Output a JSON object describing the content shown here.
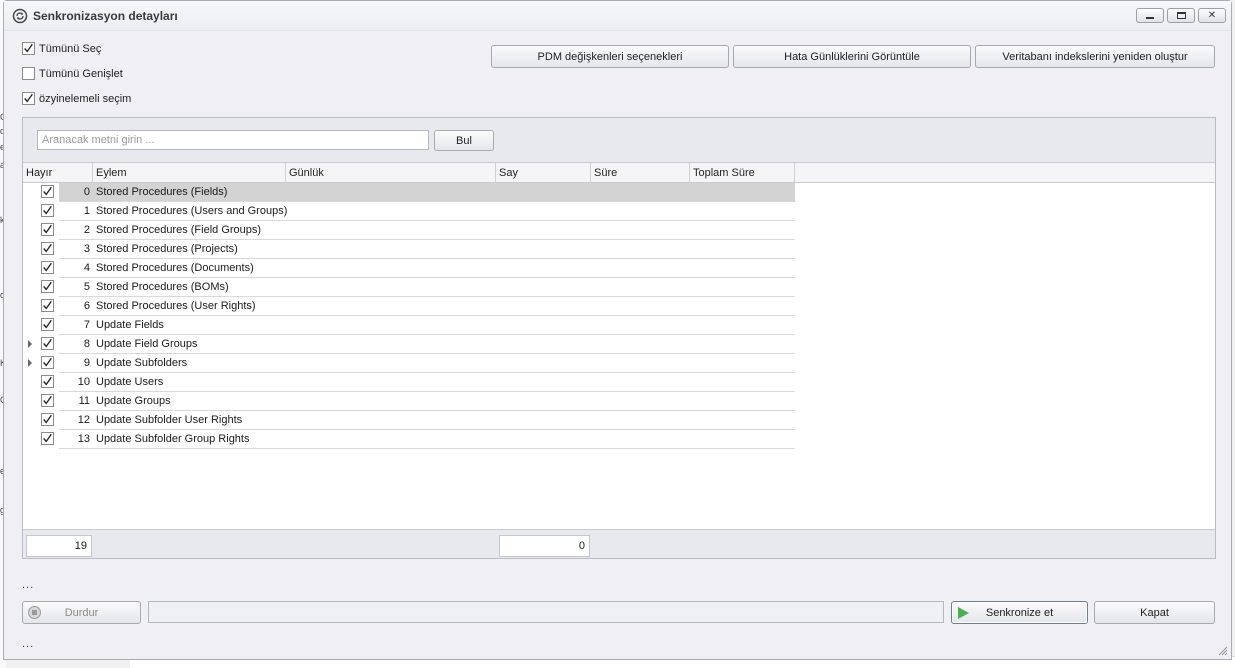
{
  "window": {
    "title": "Senkronizasyon detayları"
  },
  "options": {
    "select_all": {
      "label": "Tümünü Seç",
      "checked": true
    },
    "expand_all": {
      "label": "Tümünü Genişlet",
      "checked": false
    },
    "recursive": {
      "label": "özyinelemeli seçim",
      "checked": true
    }
  },
  "toolbar": {
    "pdm_options": "PDM değişkenleri seçenekleri",
    "view_error_logs": "Hata Günlüklerini Görüntüle",
    "rebuild_indexes": "Veritabanı indekslerini yeniden oluştur"
  },
  "search": {
    "placeholder": "Aranacak metni girin ...",
    "button": "Bul"
  },
  "grid": {
    "columns": [
      "Hayır",
      "Eylem",
      "Günlük",
      "Say",
      "Süre",
      "Toplam Süre"
    ],
    "rows": [
      {
        "no": "0",
        "action": "Stored Procedures (Fields)"
      },
      {
        "no": "1",
        "action": "Stored Procedures (Users and Groups)"
      },
      {
        "no": "2",
        "action": "Stored Procedures (Field Groups)"
      },
      {
        "no": "3",
        "action": "Stored Procedures (Projects)"
      },
      {
        "no": "4",
        "action": "Stored Procedures (Documents)"
      },
      {
        "no": "5",
        "action": "Stored Procedures (BOMs)"
      },
      {
        "no": "6",
        "action": "Stored Procedures (User Rights)"
      },
      {
        "no": "7",
        "action": "Update Fields"
      },
      {
        "no": "8",
        "action": "Update Field Groups"
      },
      {
        "no": "9",
        "action": "Update Subfolders"
      },
      {
        "no": "10",
        "action": "Update Users"
      },
      {
        "no": "11",
        "action": "Update Groups"
      },
      {
        "no": "12",
        "action": "Update Subfolder User Rights"
      },
      {
        "no": "13",
        "action": "Update Subfolder Group Rights"
      }
    ],
    "footer_total": "19",
    "footer_count": "0"
  },
  "status": {
    "upper": "...",
    "lower": "..."
  },
  "actions": {
    "stop": "Durdur",
    "sync": "Senkronize et",
    "close": "Kapat"
  },
  "colors": {
    "selected_row": "#d3d3d3",
    "sync_icon": "#4caf50"
  }
}
